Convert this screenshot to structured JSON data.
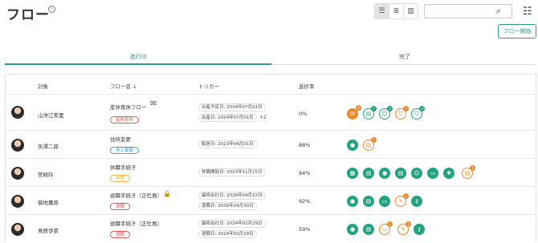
{
  "header": {
    "title": "フロー",
    "start_button": "フロー開始",
    "search": {
      "placeholder": ""
    }
  },
  "tabs": [
    "進行中",
    "完了"
  ],
  "columns": [
    "対象",
    "フロー名 ↓",
    "トリガー",
    "進捗率"
  ],
  "rows": [
    {
      "name": "山沖江美里",
      "flow": "産休育休フロー",
      "tag": "産休育休",
      "triggers": [
        "出産予定日: 2024年07月01日",
        "出産日: 2024年07月01日"
      ],
      "more": "+2",
      "progress": "0%",
      "icons": [
        {
          "b": "4"
        },
        {
          "b": "7"
        },
        {
          "b": "3"
        },
        {
          "b": "1"
        },
        {
          "b": "3"
        }
      ]
    },
    {
      "name": "矢澤二郎",
      "flow": "住所変更",
      "tag": "身上異動",
      "triggers": [
        "転居日: 2023年04月01日"
      ],
      "progress": "88%",
      "icons": [
        {
          "b": ""
        },
        {
          "b": "1"
        }
      ]
    },
    {
      "name": "宮崎玲",
      "flow": "休職手続き",
      "tag": "休職",
      "triggers": [
        "休職開始日: 2023年11月15日"
      ],
      "progress": "94%",
      "icons": [
        {
          "b": ""
        },
        {
          "b": ""
        },
        {
          "b": ""
        },
        {
          "b": ""
        },
        {
          "b": ""
        },
        {
          "b": ""
        },
        {
          "b": ""
        },
        {
          "b": "1"
        }
      ]
    },
    {
      "name": "菊地薫郎",
      "flow": "退職手続き（正社員）",
      "tag": "退職",
      "triggers": [
        "最終出社日: 2026年04月22日",
        "退職日: 2026年04月30日"
      ],
      "progress": "92%",
      "icons": [
        {
          "b": ""
        },
        {
          "b": ""
        },
        {
          "b": ""
        },
        {
          "b": "1"
        },
        {
          "b": ""
        }
      ]
    },
    {
      "name": "鳥居歩菜",
      "flow": "退職手続き（正社員）",
      "tag": "退職",
      "triggers": [
        "最終出社日: 2024年02月29日",
        "退職日: 2024年02月29日"
      ],
      "progress": "59%",
      "icons": [
        {
          "b": ""
        },
        {
          "b": ""
        },
        {
          "b": "1"
        },
        {
          "b": "1"
        },
        {
          "b": ""
        }
      ]
    }
  ]
}
